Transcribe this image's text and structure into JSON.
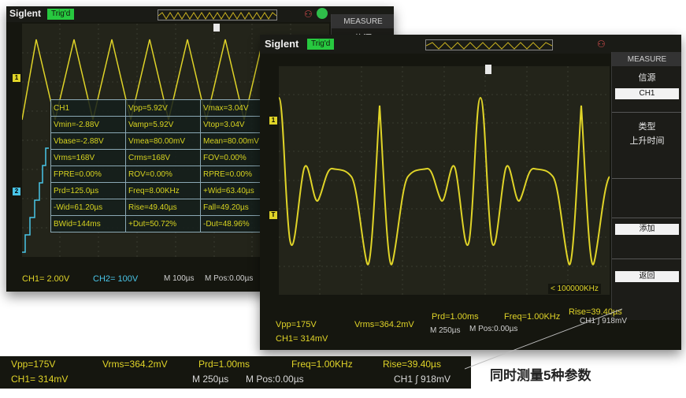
{
  "scope1": {
    "brand": "Siglent",
    "status": "Trig'd",
    "menu_title": "MEASURE",
    "menu_item": "信源",
    "measurements": [
      [
        "CH1",
        "Vpp=5.92V",
        "Vmax=3.04V"
      ],
      [
        "Vmin=-2.88V",
        "Vamp=5.92V",
        "Vtop=3.04V"
      ],
      [
        "Vbase=-2.88V",
        "Vmea=80.00mV",
        "Mean=80.00mV"
      ],
      [
        "Vrms=168V",
        "Crms=168V",
        "FOV=0.00%"
      ],
      [
        "FPRE=0.00%",
        "ROV=0.00%",
        "RPRE=0.00%"
      ],
      [
        "Prd=125.0µs",
        "Freq=8.00KHz",
        "+Wid=63.40µs"
      ],
      [
        "-Wid=61.20µs",
        "Rise=49.40µs",
        "Fall=49.20µs"
      ],
      [
        "BWid=144ms",
        "+Dut=50.72%",
        "-Dut=48.96%"
      ]
    ],
    "status_bar": {
      "ch1": "CH1= 2.00V",
      "ch2": "CH2= 100V",
      "timebase": "M 100µs",
      "mpos": "M Pos:0.00µs"
    }
  },
  "scope2": {
    "brand": "Siglent",
    "status": "Trig'd",
    "menu": {
      "title": "MEASURE",
      "source_label": "信源",
      "source_value": "CH1",
      "type_label": "类型",
      "type_value": "上升时间",
      "add_button": "添加",
      "back_button": "返回"
    },
    "freq_readout": "< 100000KHz",
    "status_bar": {
      "vpp": "Vpp=175V",
      "vrms": "Vrms=364.2mV",
      "prd": "Prd=1.00ms",
      "freq": "Freq=1.00KHz",
      "rise": "Rise=39.40µs",
      "ch1": "CH1= 314mV",
      "timebase": "M 250µs",
      "mpos": "M Pos:0.00µs",
      "trig": "CH1 ∫ 918mV"
    }
  },
  "bottom_strip": {
    "vpp": "Vpp=175V",
    "vrms": "Vrms=364.2mV",
    "prd": "Prd=1.00ms",
    "freq": "Freq=1.00KHz",
    "rise": "Rise=39.40µs",
    "ch1": "CH1= 314mV",
    "timebase": "M 250µs",
    "mpos": "M Pos:0.00µs",
    "trig": "CH1 ∫ 918mV"
  },
  "caption": "同时测量5种参数",
  "colors": {
    "trace_yellow": "#e0d428",
    "trace_cyan": "#49c5e8",
    "trig_green": "#27c93f",
    "screen_bg": "#15160f"
  }
}
